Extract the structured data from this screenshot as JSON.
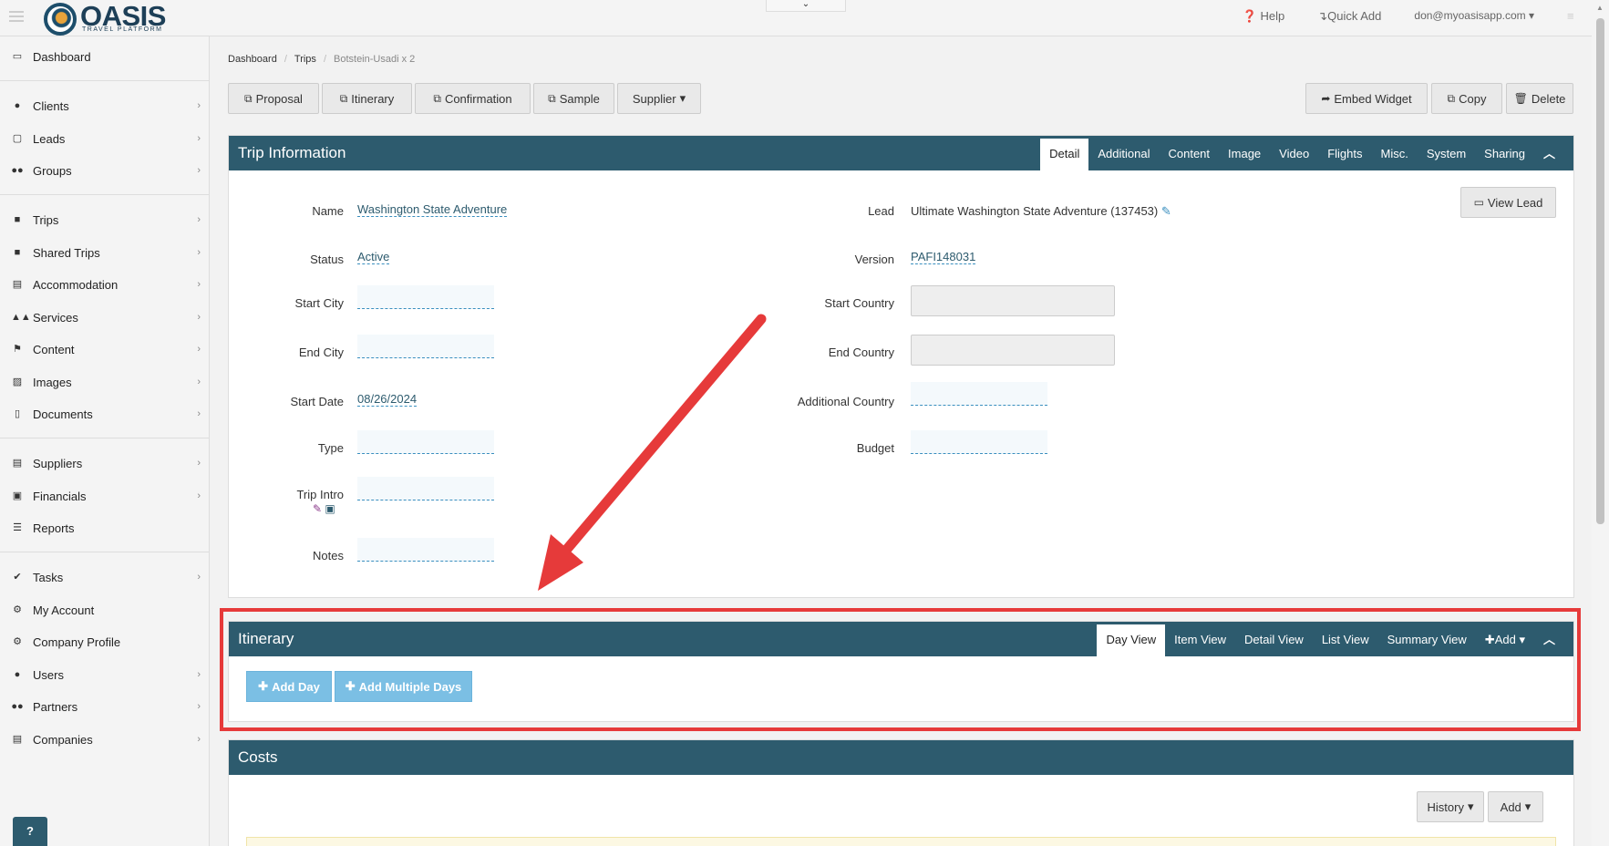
{
  "topbar": {
    "logo_text": "OASIS",
    "logo_sub": "TRAVEL PLATFORM",
    "help": "Help",
    "quick_add": "Quick Add",
    "user": "don@myoasisapp.com"
  },
  "sidebar": {
    "items": [
      {
        "label": "Dashboard",
        "icon": "monitor-icon",
        "chev": false
      },
      {
        "label": "Clients",
        "icon": "user-icon",
        "chev": true
      },
      {
        "label": "Leads",
        "icon": "inbox-icon",
        "chev": true
      },
      {
        "label": "Groups",
        "icon": "users-icon",
        "chev": true
      },
      {
        "label": "Trips",
        "icon": "briefcase-icon",
        "chev": true
      },
      {
        "label": "Shared Trips",
        "icon": "briefcase-icon",
        "chev": true
      },
      {
        "label": "Accommodation",
        "icon": "building-icon",
        "chev": true
      },
      {
        "label": "Services",
        "icon": "binoculars-icon",
        "chev": true
      },
      {
        "label": "Content",
        "icon": "flag-icon",
        "chev": true
      },
      {
        "label": "Images",
        "icon": "image-icon",
        "chev": true
      },
      {
        "label": "Documents",
        "icon": "document-icon",
        "chev": true
      },
      {
        "label": "Suppliers",
        "icon": "building-icon",
        "chev": true
      },
      {
        "label": "Financials",
        "icon": "money-icon",
        "chev": true
      },
      {
        "label": "Reports",
        "icon": "list-icon",
        "chev": false
      },
      {
        "label": "Tasks",
        "icon": "check-icon",
        "chev": true
      },
      {
        "label": "My Account",
        "icon": "gear-icon",
        "chev": false
      },
      {
        "label": "Company Profile",
        "icon": "gears-icon",
        "chev": false
      },
      {
        "label": "Users",
        "icon": "user-icon",
        "chev": true
      },
      {
        "label": "Partners",
        "icon": "users-icon",
        "chev": true
      },
      {
        "label": "Companies",
        "icon": "building-icon",
        "chev": true
      }
    ],
    "help_fab": "?"
  },
  "breadcrumb": [
    "Dashboard",
    "Trips",
    "Botstein-Usadi x 2"
  ],
  "toolbar": {
    "left": [
      "Proposal",
      "Itinerary",
      "Confirmation",
      "Sample",
      "Supplier"
    ],
    "right": [
      "Embed Widget",
      "Copy",
      "Delete"
    ]
  },
  "trip_info": {
    "title": "Trip Information",
    "tabs": [
      "Detail",
      "Additional",
      "Content",
      "Image",
      "Video",
      "Flights",
      "Misc.",
      "System",
      "Sharing"
    ],
    "active_tab": "Detail",
    "labels": {
      "name": "Name",
      "status": "Status",
      "start_city": "Start City",
      "end_city": "End City",
      "start_date": "Start Date",
      "type": "Type",
      "trip_intro": "Trip Intro",
      "notes": "Notes",
      "lead": "Lead",
      "version": "Version",
      "start_country": "Start Country",
      "end_country": "End Country",
      "additional_country": "Additional Country",
      "budget": "Budget"
    },
    "values": {
      "name": "Washington State Adventure",
      "status": "Active",
      "start_date": "08/26/2024",
      "lead": "Ultimate Washington State Adventure (137453)",
      "version": "PAFI148031"
    },
    "view_lead": "View Lead"
  },
  "itinerary": {
    "title": "Itinerary",
    "tabs": [
      "Day View",
      "Item View",
      "Detail View",
      "List View",
      "Summary View"
    ],
    "active_tab": "Day View",
    "add_tab": "Add",
    "add_day": "Add Day",
    "add_multiple": "Add Multiple Days"
  },
  "costs": {
    "title": "Costs",
    "history": "History",
    "add": "Add"
  },
  "colors": {
    "header": "#2d5b6e",
    "highlight": "#e63a3a",
    "arrow": "#e63a3a",
    "add_button": "#7bbfe4"
  }
}
